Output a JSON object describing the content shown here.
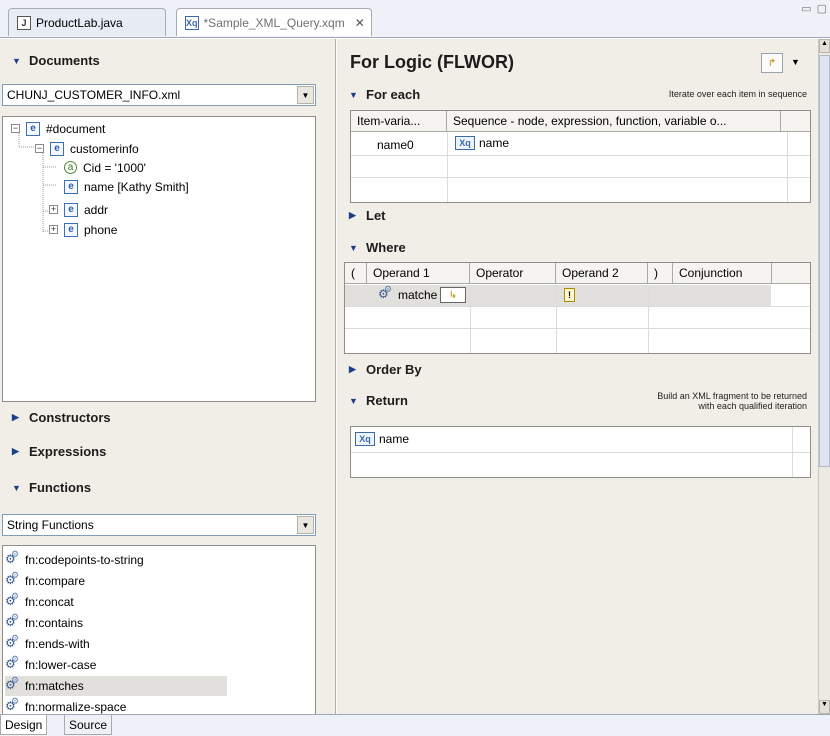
{
  "tabs": [
    {
      "label": "ProductLab.java",
      "icon": "java-file-icon"
    },
    {
      "label": "*Sample_XML_Query.xqm",
      "icon": "xquery-file-icon"
    }
  ],
  "left": {
    "documents_label": "Documents",
    "document_select": "CHUNJ_CUSTOMER_INFO.xml",
    "tree": {
      "document": "#document",
      "customerinfo": "customerinfo",
      "cid": "Cid = '1000'",
      "name": "name  [Kathy Smith]",
      "addr": "addr",
      "phone": "phone"
    },
    "constructors_label": "Constructors",
    "expressions_label": "Expressions",
    "functions_label": "Functions",
    "functions_select": "String Functions",
    "functions": [
      "fn:codepoints-to-string",
      "fn:compare",
      "fn:concat",
      "fn:contains",
      "fn:ends-with",
      "fn:lower-case",
      "fn:matches",
      "fn:normalize-space"
    ]
  },
  "right": {
    "title": "For Logic (FLWOR)",
    "for_each": {
      "label": "For each",
      "hint": "Iterate over each item in sequence",
      "col1": "Item-varia...",
      "col2": "Sequence - node, expression, function, variable o...",
      "var": "name0",
      "seq": "name"
    },
    "let_label": "Let",
    "where": {
      "label": "Where",
      "cols": [
        "(",
        "Operand 1",
        "Operator",
        "Operand 2",
        ")",
        "Conjunction"
      ],
      "operand1": "matche"
    },
    "orderby_label": "Order By",
    "return": {
      "label": "Return",
      "hint1": "Build an XML  fragment to be returned",
      "hint2": "with each qualified iteration",
      "value": "name"
    }
  },
  "bottom_tabs": [
    "Design",
    "Source"
  ],
  "colors": {
    "accent": "#1d3f8a",
    "panel": "#f1eee7",
    "selection": "#e2e0dc"
  }
}
